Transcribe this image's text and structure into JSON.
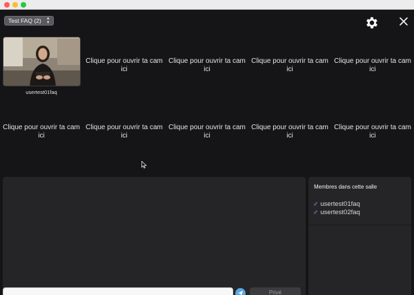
{
  "room_select": {
    "value": "Test FAQ (2)"
  },
  "cams": {
    "active_user": "usertest01faq",
    "placeholder": "Clique pour ouvrir ta cam ici"
  },
  "chat": {
    "input_placeholder": "",
    "private_label": "Privé"
  },
  "members": {
    "title": "Membres dans cette salle",
    "list": [
      "usertest01faq",
      "usertest02faq"
    ]
  },
  "colors": {
    "accent": "#5aa7e0",
    "male": "#7fb0ff"
  }
}
